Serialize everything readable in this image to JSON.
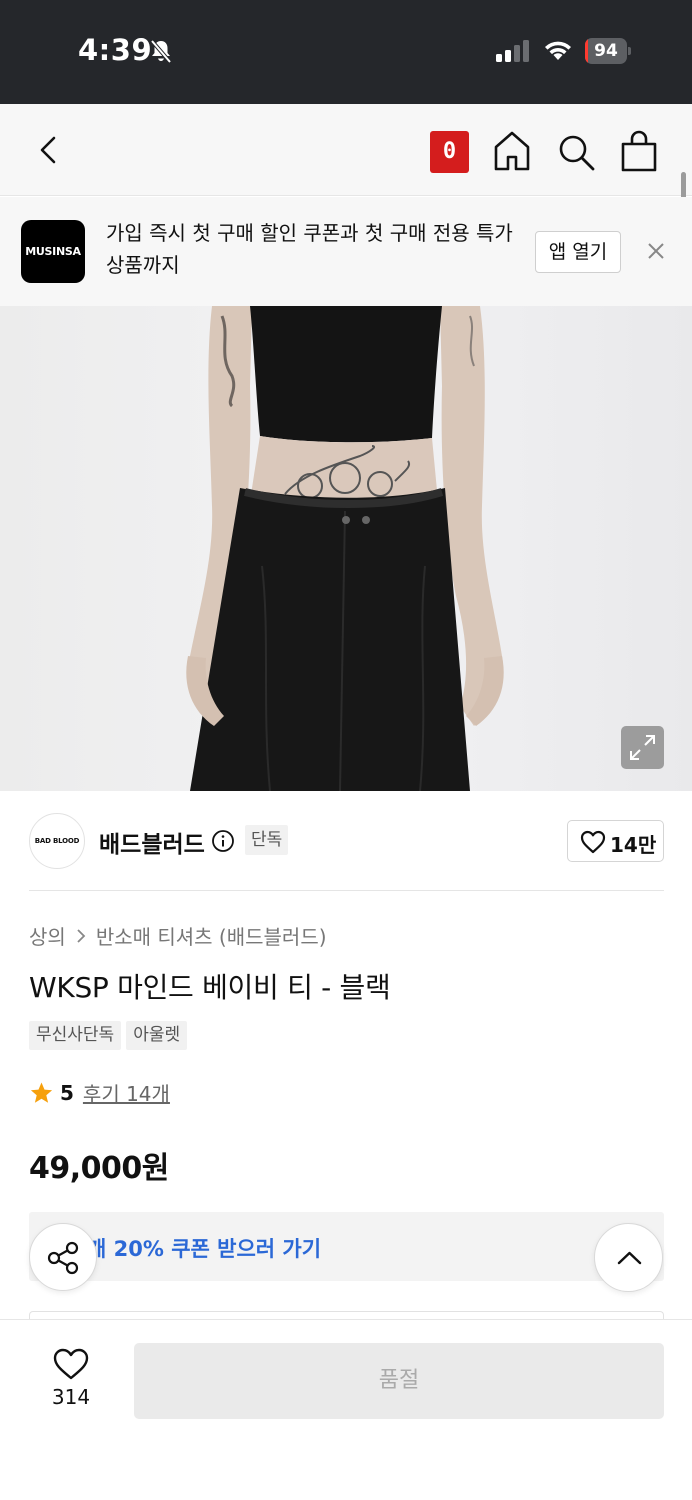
{
  "status_bar": {
    "time": "4:39",
    "battery_level": "94",
    "battery_fraction": 0.94,
    "icons": [
      "bell-off-icon",
      "signal-icon",
      "wifi-icon",
      "battery-icon"
    ]
  },
  "nav": {
    "cart_badge": "0",
    "icons": [
      "back-icon",
      "home-icon",
      "search-icon",
      "shopping-bag-icon"
    ]
  },
  "app_banner": {
    "logo_text": "MUSINSA",
    "message": "가입 즉시 첫 구매 할인 쿠폰과 첫 구매 전용 특가 상품까지",
    "open_app_label": "앱 열기"
  },
  "brand": {
    "logo_text": "BAD BLOOD",
    "name": "배드블러드",
    "exclusive_label": "단독",
    "likes": "14만"
  },
  "product": {
    "breadcrumb": {
      "category": "상의",
      "subcategory": "반소매 티셔츠 (배드블러드)"
    },
    "title": "WKSP 마인드 베이비 티 - 블랙",
    "tags": [
      "무신사단독",
      "아울렛"
    ],
    "rating": "5",
    "review_link": "후기 14개",
    "price": "49,000원"
  },
  "coupon": {
    "text": "개 20% 쿠폰 받으러 가기"
  },
  "bottom_bar": {
    "wish_count": "314",
    "soldout_label": "품절"
  },
  "colors": {
    "status_bar_bg": "#25272b",
    "badge_red": "#d41d1d",
    "coupon_blue": "#2b68d6",
    "star_orange": "#f6a00c"
  }
}
